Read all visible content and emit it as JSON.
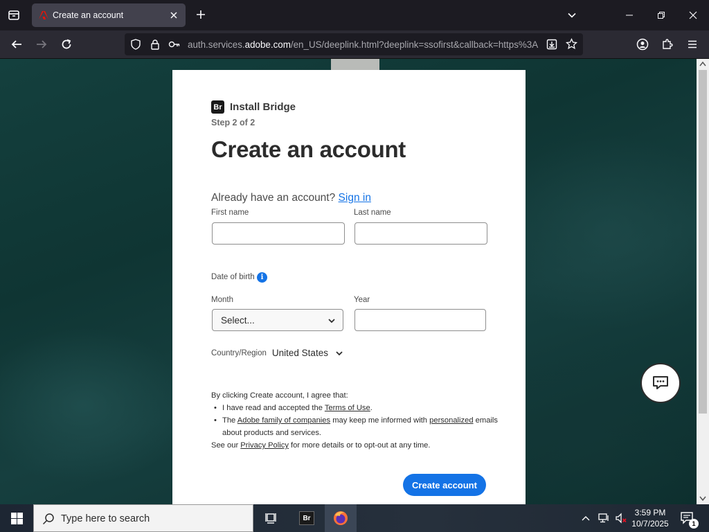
{
  "browser": {
    "tab_title": "Create an account",
    "url_host_prefix": "auth.services.",
    "url_host": "adobe.com",
    "url_path": "/en_US/deeplink.html?deeplink=ssofirst&callback=https%3A"
  },
  "page": {
    "app_logo_text": "Br",
    "app_name": "Install Bridge",
    "step": "Step 2 of 2",
    "heading": "Create an account",
    "already_text": "Already have an account? ",
    "signin_label": "Sign in",
    "first_name_label": "First name",
    "first_name_value": "",
    "last_name_label": "Last name",
    "last_name_value": "",
    "dob_label": "Date of birth",
    "dob_info_icon": "i",
    "month_label": "Month",
    "month_value": "Select...",
    "year_label": "Year",
    "year_value": "",
    "country_label": "Country/Region",
    "country_value": "United States",
    "legal_intro": "By clicking Create account, I agree that:",
    "legal_item1_pre": "I have read and accepted the ",
    "legal_item1_link": "Terms of Use",
    "legal_item1_post": ".",
    "legal_item2_pre": "The ",
    "legal_item2_link1": "Adobe family of companies",
    "legal_item2_mid": " may keep me informed with ",
    "legal_item2_link2": "personalized",
    "legal_item2_post": " emails about products and services.",
    "legal_outro_pre": "See our ",
    "legal_outro_link": "Privacy Policy",
    "legal_outro_post": " for more details or to opt-out at any time.",
    "create_button": "Create account"
  },
  "taskbar": {
    "search_placeholder": "Type here to search",
    "br_app_label": "Br",
    "time": "3:59 PM",
    "date": "10/7/2025",
    "notification_count": "1"
  },
  "colors": {
    "accent": "#1473e6",
    "browser_chrome": "#1c1b22"
  }
}
